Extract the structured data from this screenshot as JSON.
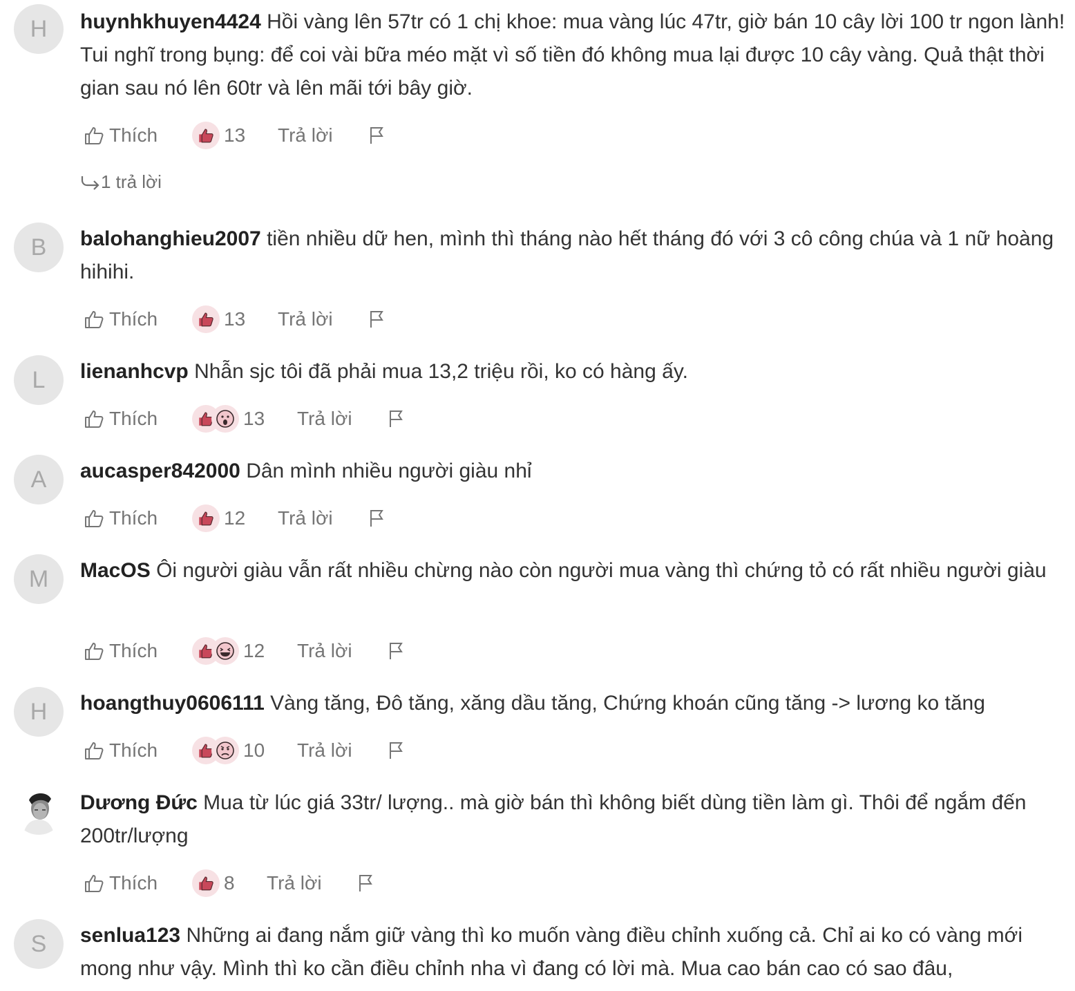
{
  "labels": {
    "like": "Thích",
    "reply": "Trả lời"
  },
  "colors": {
    "reaction_bg": "#f7e1e4",
    "reaction_like": "#c8485a",
    "avatar_bg": "#e6e6e6",
    "avatar_text": "#a8a8a8",
    "action_text": "#757575"
  },
  "icons": {
    "like": "thumbs-up-outline-icon",
    "reaction_like": "thumbs-up-filled-icon",
    "report": "flag-icon",
    "replies": "reply-arrow-icon"
  },
  "comments": [
    {
      "avatar": "H",
      "username": "huynhkhuyen4424",
      "text": "Hồi vàng lên 57tr có 1 chị khoe: mua vàng lúc 47tr, giờ bán 10 cây lời 100 tr ngon lành! Tui nghĩ trong bụng: để coi vài bữa méo mặt vì số tiền đó không mua lại được 10 cây vàng. Quả thật thời gian sau nó lên 60tr và lên mãi tới bây giờ.",
      "reactions": [
        "like"
      ],
      "count": "13",
      "replies": "1 trả lời"
    },
    {
      "avatar": "B",
      "username": "balohanghieu2007",
      "text": "tiền nhiều dữ hen, mình thì tháng nào hết tháng đó với 3 cô công chúa và 1 nữ hoàng hihihi.",
      "reactions": [
        "like"
      ],
      "count": "13"
    },
    {
      "avatar": "L",
      "username": "lienanhcvp",
      "text": "Nhẫn sjc tôi đã phải mua 13,2 triệu rồi, ko có hàng ấy.",
      "reactions": [
        "like",
        "wow"
      ],
      "count": "13"
    },
    {
      "avatar": "A",
      "username": "aucasper842000",
      "text": "Dân mình nhiều người giàu nhỉ",
      "reactions": [
        "like"
      ],
      "count": "12"
    },
    {
      "avatar": "M",
      "username": "MacOS",
      "text": "Ôi người giàu vẫn rất nhiều chừng nào còn người mua vàng thì chứng tỏ có rất nhiều người giàu",
      "reactions": [
        "like",
        "haha"
      ],
      "count": "12"
    },
    {
      "avatar": "H",
      "username": "hoangthuy0606111",
      "text": "Vàng tăng, Đô tăng, xăng dầu tăng, Chứng khoán cũng tăng -> lương ko tăng",
      "reactions": [
        "like",
        "sad"
      ],
      "count": "10"
    },
    {
      "avatar": "",
      "avatar_photo": true,
      "username": "Dương Đức",
      "text": "Mua từ lúc giá 33tr/ lượng.. mà giờ bán thì không biết dùng tiền làm gì. Thôi để ngắm đến 200tr/lượng",
      "reactions": [
        "like"
      ],
      "count": "8"
    },
    {
      "avatar": "S",
      "username": "senlua123",
      "text": "Những ai đang nắm giữ vàng thì ko muốn vàng điều chỉnh xuống cả. Chỉ ai ko có vàng mới mong như vậy. Mình thì ko cần điều chỉnh nha vì đang có lời mà. Mua cao bán cao có sao đâu,",
      "reactions": [
        "like"
      ],
      "count": null
    }
  ]
}
